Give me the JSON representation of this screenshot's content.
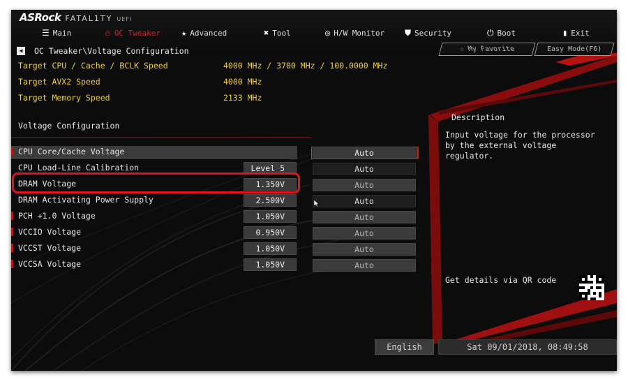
{
  "brand": {
    "asrock": "ASRock",
    "fatality": "FATAL1TY",
    "uefi": "UEFI"
  },
  "tabs": [
    {
      "label": "Main",
      "icon": "list-icon",
      "active": false
    },
    {
      "label": "OC Tweaker",
      "icon": "flame-icon",
      "active": true
    },
    {
      "label": "Advanced",
      "icon": "star-icon",
      "active": false
    },
    {
      "label": "Tool",
      "icon": "wrench-icon",
      "active": false
    },
    {
      "label": "H/W Monitor",
      "icon": "monitor-icon",
      "active": false
    },
    {
      "label": "Security",
      "icon": "shield-icon",
      "active": false
    },
    {
      "label": "Boot",
      "icon": "power-icon",
      "active": false
    },
    {
      "label": "Exit",
      "icon": "exit-icon",
      "active": false
    }
  ],
  "breadcrumb": "OC Tweaker\\Voltage Configuration",
  "favorites": {
    "my_favorite": "My Favorite",
    "easy_mode": "Easy Mode(F6)"
  },
  "targets": [
    {
      "label": "Target CPU / Cache / BCLK Speed",
      "value": "4000 MHz / 3700 MHz / 100.0000 MHz"
    },
    {
      "label": "Target AVX2 Speed",
      "value": "4000 MHz"
    },
    {
      "label": "Target Memory Speed",
      "value": "2133 MHz"
    }
  ],
  "section_title": "Voltage Configuration",
  "settings": [
    {
      "label": "CPU Core/Cache Voltage",
      "value": "",
      "mode": "Auto",
      "selected": true,
      "dim": false
    },
    {
      "label": "CPU Load-Line Calibration",
      "value": "Level 5",
      "mode": "Auto",
      "selected": false,
      "dim": false
    },
    {
      "label": "DRAM Voltage",
      "value": "1.350V",
      "mode": "Auto",
      "selected": false,
      "dim": true
    },
    {
      "label": "DRAM Activating Power Supply",
      "value": "2.500V",
      "mode": "Auto",
      "selected": false,
      "dim": false
    },
    {
      "label": "PCH +1.0 Voltage",
      "value": "1.050V",
      "mode": "Auto",
      "selected": false,
      "dim": true
    },
    {
      "label": "VCCIO Voltage",
      "value": "0.950V",
      "mode": "Auto",
      "selected": false,
      "dim": true
    },
    {
      "label": "VCCST Voltage",
      "value": "1.050V",
      "mode": "Auto",
      "selected": false,
      "dim": true
    },
    {
      "label": "VCCSA Voltage",
      "value": "1.050V",
      "mode": "Auto",
      "selected": false,
      "dim": true
    }
  ],
  "description": {
    "title": "Description",
    "text": "Input voltage for the processor by the external voltage regulator.",
    "qr_label": "Get details via QR code"
  },
  "footer": {
    "language": "English",
    "datetime": "Sat 09/01/2018, 08:49:58"
  },
  "colors": {
    "accent": "#e02020",
    "target_text": "#f2d23a",
    "highlight": "#e1141c"
  }
}
